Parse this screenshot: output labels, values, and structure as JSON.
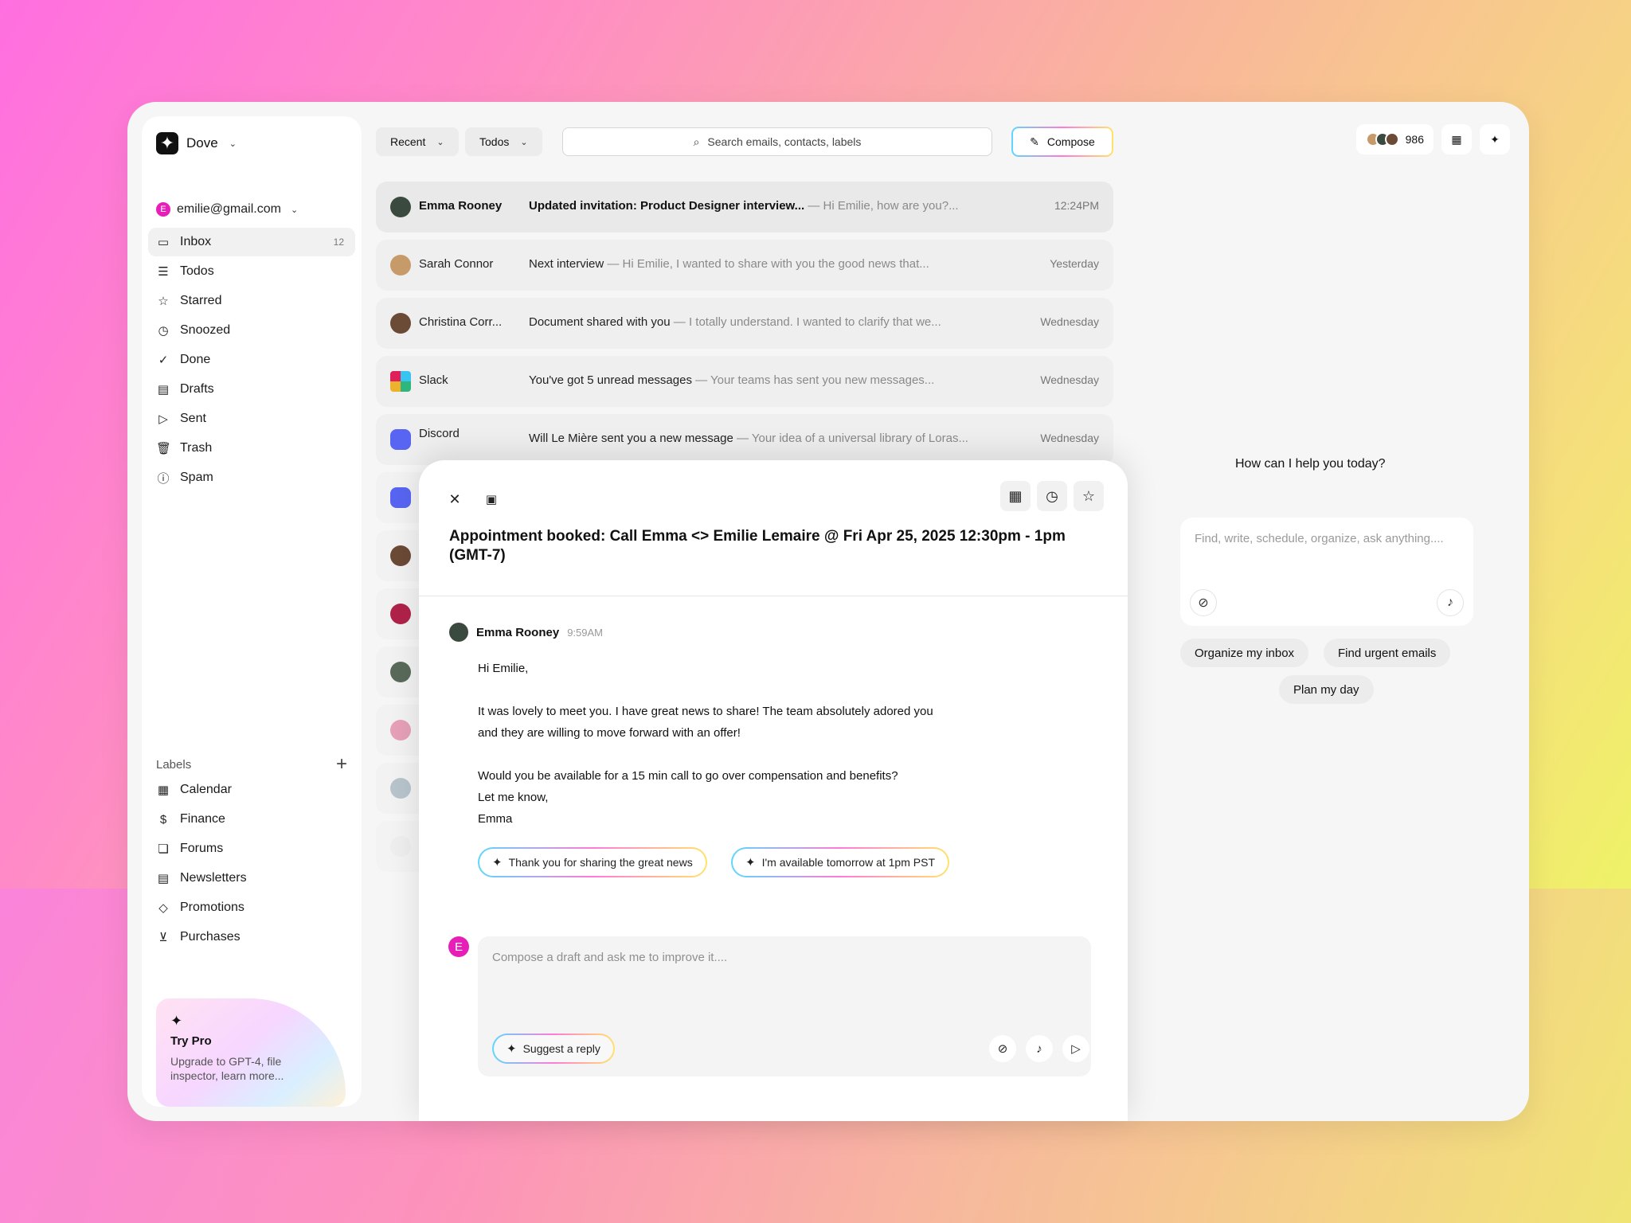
{
  "app": {
    "name": "Dove",
    "account": "emilie@gmail.com",
    "account_initial": "E"
  },
  "nav": [
    {
      "label": "Inbox",
      "icon": "inbox-icon",
      "count": "12"
    },
    {
      "label": "Todos",
      "icon": "todos-icon"
    },
    {
      "label": "Starred",
      "icon": "star-icon"
    },
    {
      "label": "Snoozed",
      "icon": "clock-icon"
    },
    {
      "label": "Done",
      "icon": "check-icon"
    },
    {
      "label": "Drafts",
      "icon": "drafts-icon"
    },
    {
      "label": "Sent",
      "icon": "send-icon"
    },
    {
      "label": "Trash",
      "icon": "trash-icon"
    },
    {
      "label": "Spam",
      "icon": "spam-icon"
    }
  ],
  "labels_title": "Labels",
  "labels": [
    {
      "label": "Calendar",
      "icon": "calendar-icon"
    },
    {
      "label": "Finance",
      "icon": "dollar-icon"
    },
    {
      "label": "Forums",
      "icon": "forums-icon"
    },
    {
      "label": "Newsletters",
      "icon": "newsletter-icon"
    },
    {
      "label": "Promotions",
      "icon": "tag-icon"
    },
    {
      "label": "Purchases",
      "icon": "cart-icon"
    }
  ],
  "promo": {
    "title": "Try Pro",
    "desc": "Upgrade to GPT-4, file inspector, learn more..."
  },
  "toolbar": {
    "recent": "Recent",
    "todos": "Todos",
    "search_placeholder": "Search emails, contacts, labels",
    "compose": "Compose"
  },
  "emails": [
    {
      "from": "Emma Rooney",
      "subject": "Updated invitation: Product Designer interview...",
      "preview": "Hi Emilie, how are you?...",
      "time": "12:24PM",
      "avatar": "#3b4a3f"
    },
    {
      "from": "Sarah Connor",
      "subject": "Next interview",
      "preview": "Hi Emilie, I wanted to share with you the good news that...",
      "time": "Yesterday",
      "avatar": "#c79a6a"
    },
    {
      "from": "Christina Corr...",
      "subject": "Document shared with you",
      "preview": "I totally understand. I wanted to clarify that we...",
      "time": "Wednesday",
      "avatar": "#6b4a36"
    },
    {
      "from": "Slack",
      "subject": "You've got 5 unread messages",
      "preview": "Your teams has sent you new messages...",
      "time": "Wednesday",
      "avatar": "slack"
    },
    {
      "from": "Discord",
      "subject": "Will Le Mière sent you a new message",
      "preview": "Your idea of a universal library of Loras...",
      "time": "Wednesday",
      "avatar": "#5865f2"
    }
  ],
  "ghost_avatars": [
    "#5865f2",
    "#6b4a36",
    "#b0224a",
    "#5a6a5a",
    "#e6a0b8",
    "#b8c4cc",
    "#e8e8e8"
  ],
  "top_right": {
    "count": "986"
  },
  "assistant": {
    "prompt": "How can I help you today?",
    "placeholder": "Find, write, schedule, organize, ask anything....",
    "chips": [
      "Organize my inbox",
      "Find urgent emails",
      "Plan my day"
    ]
  },
  "detail": {
    "title": "Appointment booked: Call Emma <> Emilie Lemaire @ Fri Apr 25, 2025 12:30pm - 1pm (GMT-7)",
    "sender": "Emma Rooney",
    "time": "9:59AM",
    "greeting": "Hi Emilie,",
    "p1a": "It was lovely to meet you. I have great news to share! The team absolutely adored you",
    "p1b": "and they are willing to move forward with an offer!",
    "p2a": "Would you be available for a 15 min call to go over compensation and benefits?",
    "p2b": "Let me know,",
    "sign": "Emma",
    "suggestions": [
      "Thank you for sharing the great news",
      "I'm available tomorrow at 1pm PST"
    ],
    "composer_placeholder": "Compose a draft and ask me to improve it....",
    "suggest_reply": "Suggest a reply"
  }
}
